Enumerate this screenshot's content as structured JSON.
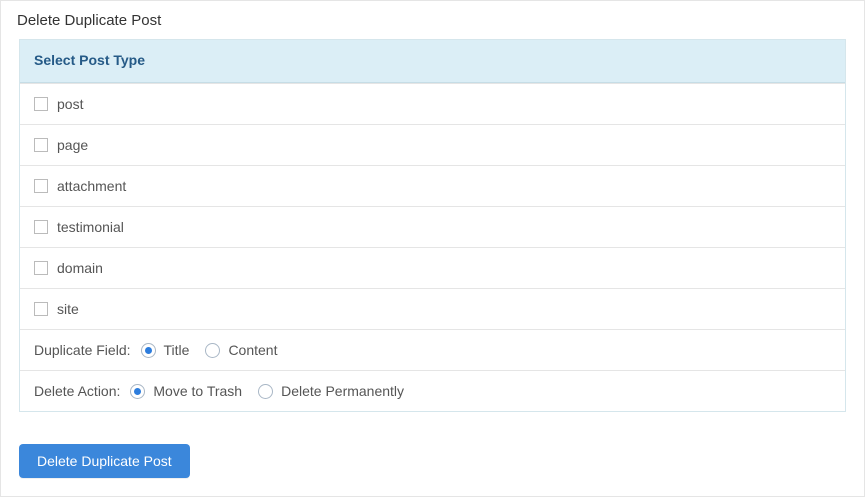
{
  "page": {
    "title": "Delete Duplicate Post"
  },
  "panel": {
    "header": "Select Post Type",
    "postTypes": [
      {
        "label": "post",
        "checked": false
      },
      {
        "label": "page",
        "checked": false
      },
      {
        "label": "attachment",
        "checked": false
      },
      {
        "label": "testimonial",
        "checked": false
      },
      {
        "label": "domain",
        "checked": false
      },
      {
        "label": "site",
        "checked": false
      }
    ],
    "duplicateField": {
      "label": "Duplicate Field:",
      "options": [
        {
          "label": "Title",
          "checked": true
        },
        {
          "label": "Content",
          "checked": false
        }
      ]
    },
    "deleteAction": {
      "label": "Delete Action:",
      "options": [
        {
          "label": "Move to Trash",
          "checked": true
        },
        {
          "label": "Delete Permanently",
          "checked": false
        }
      ]
    }
  },
  "button": {
    "label": "Delete Duplicate Post"
  }
}
